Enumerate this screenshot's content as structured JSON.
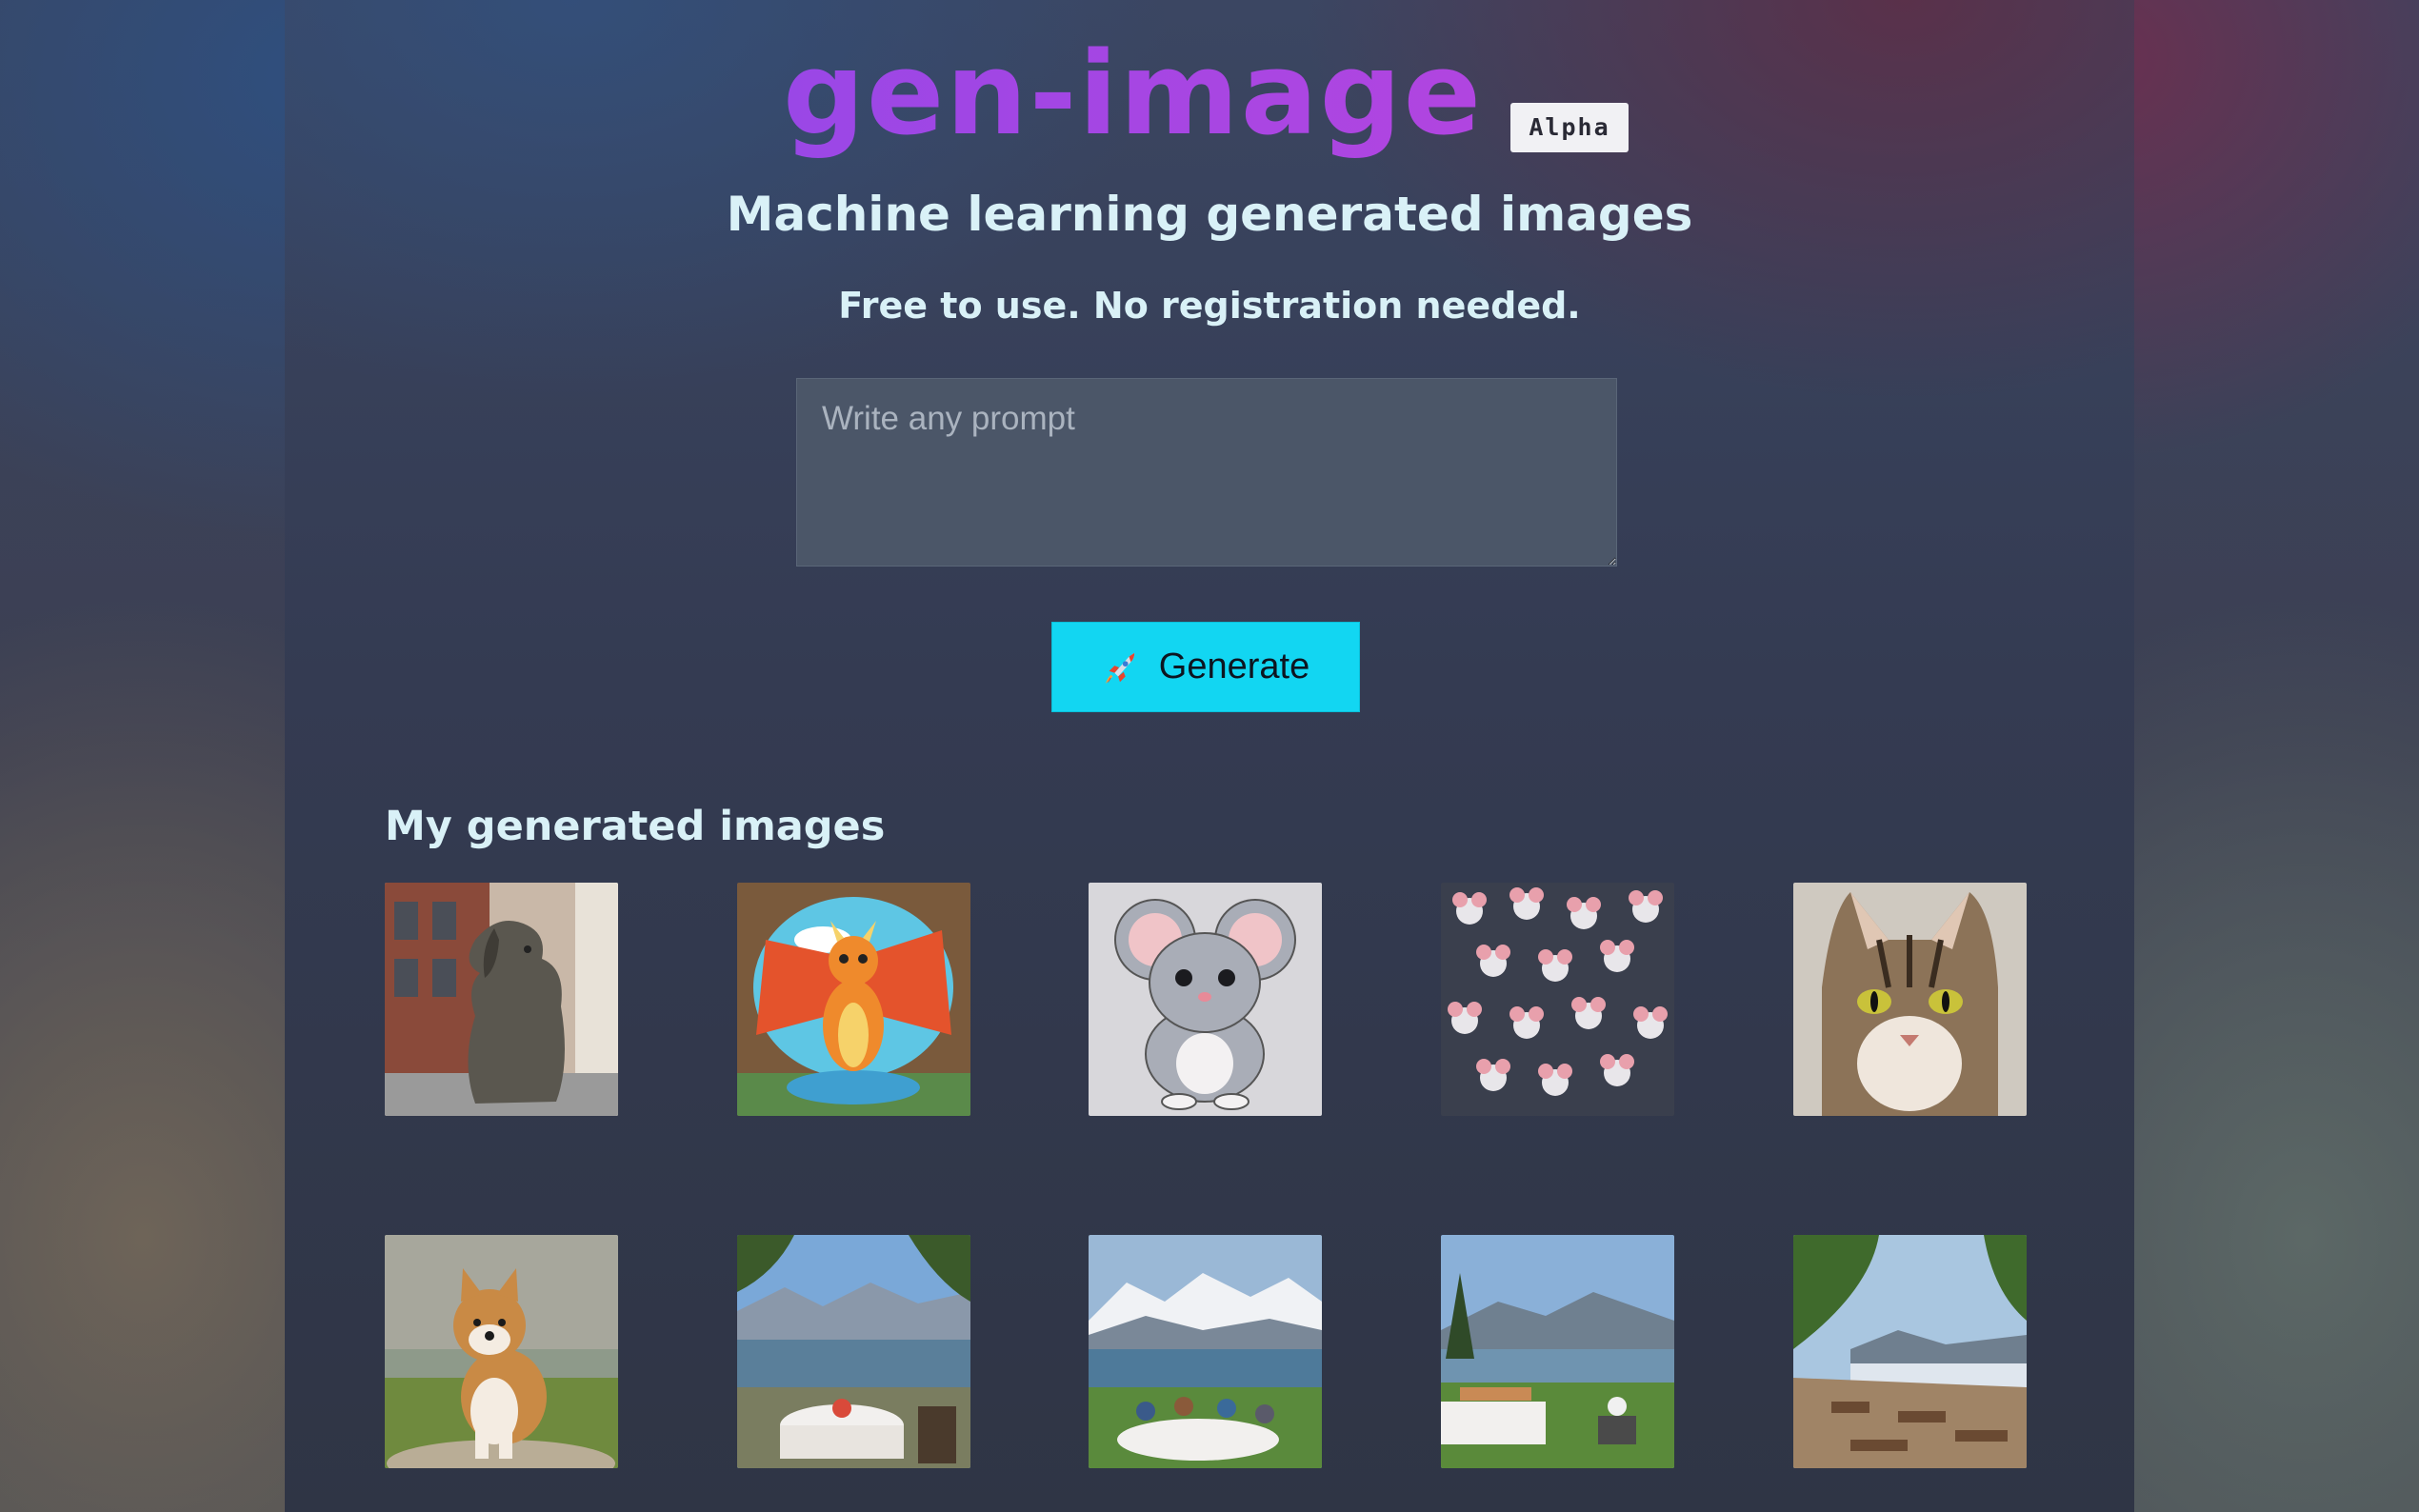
{
  "header": {
    "title": "gen-image",
    "badge": "Alpha",
    "subtitle": "Machine learning generated images",
    "tagline": "Free to use. No registration needed."
  },
  "prompt": {
    "placeholder": "Write any prompt",
    "value": ""
  },
  "generate_button": {
    "icon": "rocket-icon",
    "label": "Generate"
  },
  "gallery": {
    "title": "My generated images",
    "images": [
      {
        "subject": "dog statue in city street"
      },
      {
        "subject": "cartoon orange dragon"
      },
      {
        "subject": "cartoon gray mouse"
      },
      {
        "subject": "mouse pattern"
      },
      {
        "subject": "tabby cat portrait"
      },
      {
        "subject": "shiba inu dog"
      },
      {
        "subject": "lakeside dining table"
      },
      {
        "subject": "picnic with mountains"
      },
      {
        "subject": "lakeside picnic table"
      },
      {
        "subject": "lakeside terrace restaurant"
      }
    ]
  },
  "colors": {
    "accent": "#12d6f2",
    "title_purple": "#9a47e6",
    "text_light": "#d9f1f7"
  }
}
